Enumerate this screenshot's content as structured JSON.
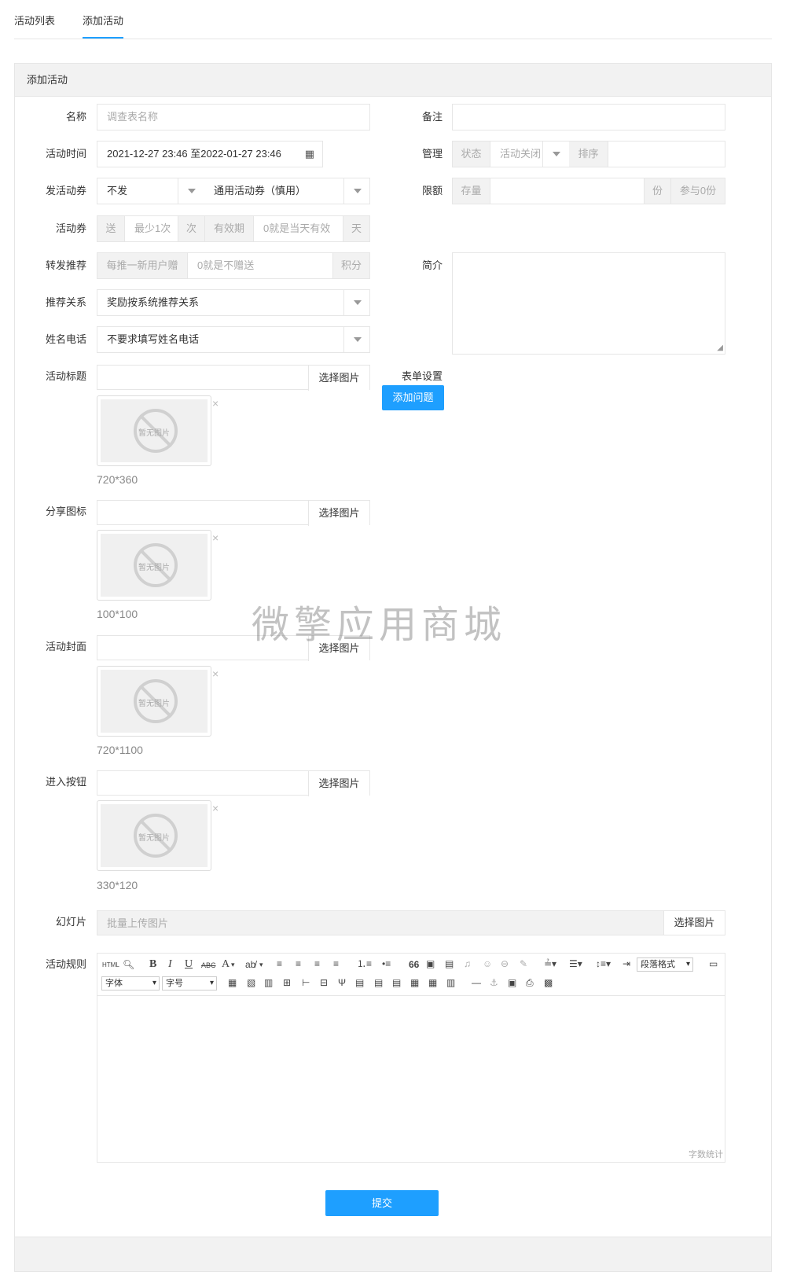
{
  "tabs": {
    "list": "活动列表",
    "add": "添加活动"
  },
  "panel_title": "添加活动",
  "labels": {
    "name": "名称",
    "time": "活动时间",
    "send_coupon": "发活动券",
    "coupon": "活动券",
    "share": "转发推荐",
    "relation": "推荐关系",
    "contact": "姓名电话",
    "title_img": "活动标题",
    "share_icon": "分享图标",
    "cover": "活动封面",
    "enter_btn": "进入按钮",
    "slides": "幻灯片",
    "rules": "活动规则",
    "remark": "备注",
    "manage": "管理",
    "limit": "限额",
    "intro": "简介",
    "form_set": "表单设置"
  },
  "fields": {
    "name_placeholder": "调查表名称",
    "time_value": "2021-12-27 23:46 至2022-01-27 23:46",
    "send_coupon_value": "不发",
    "coupon_type_value": "通用活动券（慎用）",
    "coupon_send": "送",
    "coupon_min_placeholder": "最少1次",
    "coupon_times": "次",
    "coupon_valid": "有效期",
    "coupon_valid_placeholder": "0就是当天有效",
    "coupon_day": "天",
    "share_prefix": "每推一新用户赠",
    "share_placeholder": "0就是不赠送",
    "share_unit": "积分",
    "relation_value": "奖励按系统推荐关系",
    "contact_value": "不要求填写姓名电话",
    "manage_status": "状态",
    "manage_status_value": "活动关闭",
    "manage_sort": "排序",
    "limit_stock": "存量",
    "limit_unit": "份",
    "limit_joined": "参与0份",
    "slides_placeholder": "批量上传图片"
  },
  "buttons": {
    "pick_image": "选择图片",
    "add_question": "添加问题",
    "submit": "提交"
  },
  "image_sizes": {
    "title": "720*360",
    "share": "100*100",
    "cover": "720*1100",
    "enter": "330*120"
  },
  "no_image_text": "暂无图片",
  "delete_mark": "×",
  "watermark": "微擎应用商城",
  "editor": {
    "font_label": "字体",
    "size_label": "字号",
    "paragraph_label": "段落格式",
    "word_count": "字数统计",
    "html_btn": "HTML",
    "bold": "B",
    "italic": "I",
    "underline": "U",
    "strike": "ABC",
    "fontcolor": "A",
    "quote": "66"
  },
  "colors": {
    "accent": "#1E9FFF",
    "border": "#e6e6e6",
    "addon_bg": "#f2f2f2"
  }
}
